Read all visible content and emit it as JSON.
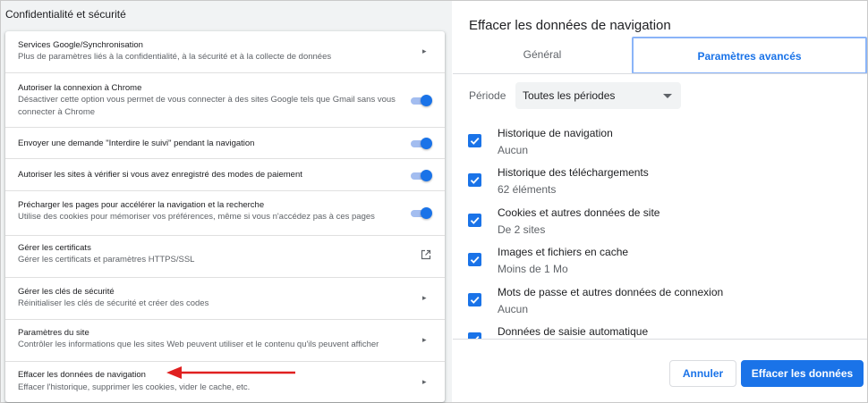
{
  "left_panel": {
    "section_title": "Confidentialité et sécurité",
    "rows": [
      {
        "title": "Services Google/Synchronisation",
        "subtitle": "Plus de paramètres liés à la confidentialité, à la sécurité et à la collecte de données",
        "control": "chevron"
      },
      {
        "title": "Autoriser la connexion à Chrome",
        "subtitle": "Désactiver cette option vous permet de vous connecter à des sites Google tels que Gmail sans vous connecter à Chrome",
        "control": "toggle-on"
      },
      {
        "title": "Envoyer une demande \"Interdire le suivi\" pendant la navigation",
        "subtitle": "",
        "control": "toggle-on"
      },
      {
        "title": "Autoriser les sites à vérifier si vous avez enregistré des modes de paiement",
        "subtitle": "",
        "control": "toggle-on"
      },
      {
        "title": "Précharger les pages pour accélérer la navigation et la recherche",
        "subtitle": "Utilise des cookies pour mémoriser vos préférences, même si vous n'accédez pas à ces pages",
        "control": "toggle-on"
      },
      {
        "title": "Gérer les certificats",
        "subtitle": "Gérer les certificats et paramètres HTTPS/SSL",
        "control": "external-link-icon"
      },
      {
        "title": "Gérer les clés de sécurité",
        "subtitle": "Réinitialiser les clés de sécurité et créer des codes",
        "control": "chevron"
      },
      {
        "title": "Paramètres du site",
        "subtitle": "Contrôler les informations que les sites Web peuvent utiliser et le contenu qu'ils peuvent afficher",
        "control": "chevron"
      },
      {
        "title": "Effacer les données de navigation",
        "subtitle": "Effacer l'historique, supprimer les cookies, vider le cache, etc.",
        "control": "chevron"
      }
    ],
    "annotation_arrow_color": "#e02020"
  },
  "dialog": {
    "title": "Effacer les données de navigation",
    "tabs": [
      {
        "label": "Général",
        "active": false
      },
      {
        "label": "Paramètres avancés",
        "active": true
      }
    ],
    "period_label": "Période",
    "period_value": "Toutes les périodes",
    "items": [
      {
        "title": "Historique de navigation",
        "subtitle": "Aucun",
        "checked": true
      },
      {
        "title": "Historique des téléchargements",
        "subtitle": "62 éléments",
        "checked": true
      },
      {
        "title": "Cookies et autres données de site",
        "subtitle": "De 2 sites",
        "checked": true
      },
      {
        "title": "Images et fichiers en cache",
        "subtitle": "Moins de 1 Mo",
        "checked": true
      },
      {
        "title": "Mots de passe et autres données de connexion",
        "subtitle": "Aucun",
        "checked": true
      },
      {
        "title": "Données de saisie automatique",
        "subtitle": "",
        "checked": true
      }
    ],
    "cancel_label": "Annuler",
    "confirm_label": "Effacer les données",
    "accent_color": "#1a73e8"
  }
}
